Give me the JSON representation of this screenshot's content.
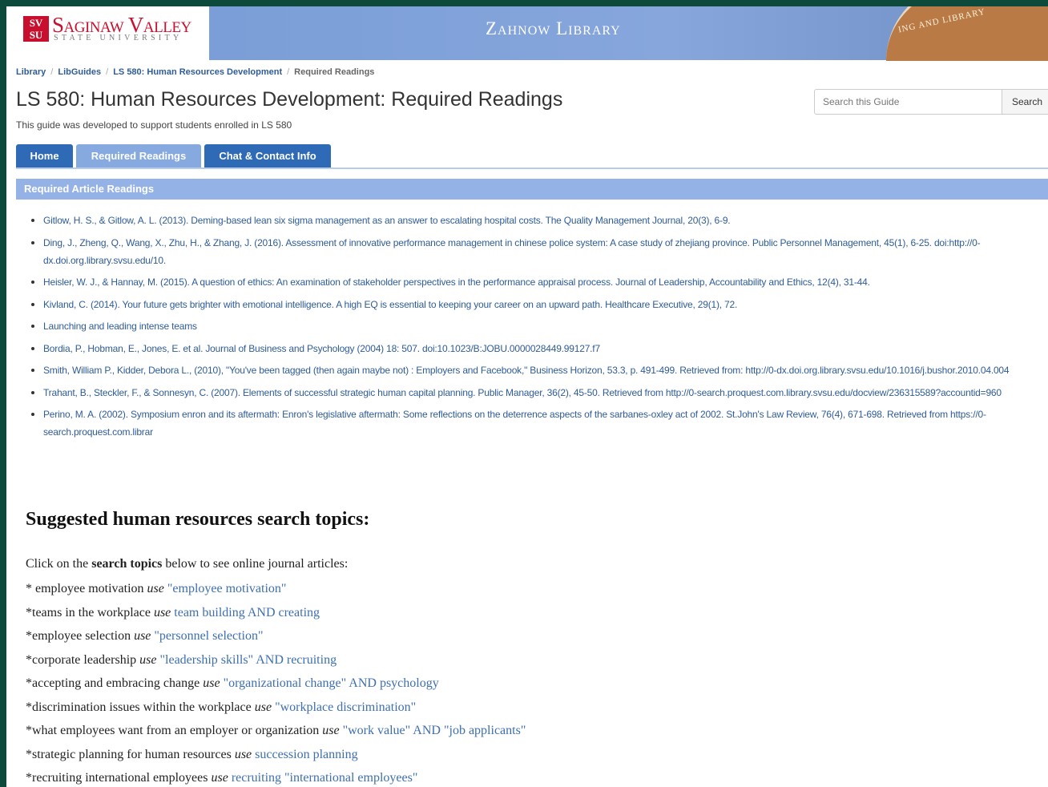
{
  "header": {
    "logo_mark": "SV SU",
    "logo_name": "Saginaw Valley",
    "logo_sub": "STATE UNIVERSITY",
    "library_title": "Zahnow Library",
    "building_sign": "ING AND LIBRARY"
  },
  "breadcrumb": [
    {
      "label": "Library"
    },
    {
      "label": "LibGuides"
    },
    {
      "label": "LS 580: Human Resources Development"
    },
    {
      "label": "Required Readings"
    }
  ],
  "page": {
    "title": "LS 580: Human Resources Development: Required Readings",
    "description": "This guide was developed to support students enrolled in LS 580"
  },
  "search": {
    "placeholder": "Search this Guide",
    "button_label": "Search"
  },
  "tabs": [
    {
      "label": "Home",
      "active": false
    },
    {
      "label": "Required Readings",
      "active": true
    },
    {
      "label": "Chat & Contact Info",
      "active": false
    }
  ],
  "box": {
    "title": "Required Article Readings",
    "readings": [
      "Gitlow, H. S., & Gitlow, A. L. (2013). Deming-based lean six sigma management as an answer to escalating hospital costs. The Quality Management Journal, 20(3), 6-9.",
      "Ding, J., Zheng, Q., Wang, X., Zhu, H., & Zhang, J. (2016). Assessment of innovative performance management in chinese police system: A case study of zhejiang province. Public Personnel Management, 45(1), 6-25. doi:http://0-dx.doi.org.library.svsu.edu/10.",
      "Heisler, W. J., & Hannay, M. (2015). A question of ethics: An examination of stakeholder perspectives in the performance appraisal process. Journal of Leadership, Accountability and Ethics, 12(4), 31-44.",
      "Kivland, C. (2014). Your future gets brighter with emotional intelligence. A high EQ is essential to keeping your career on an upward path. Healthcare Executive, 29(1), 72.",
      "Launching and leading intense teams",
      "Bordia, P., Hobman, E., Jones, E. et al. Journal of Business and Psychology (2004) 18: 507. doi:10.1023/B:JOBU.0000028449.99127.f7",
      "Smith, William P., Kidder, Debora L., (2010), \"You've been tagged (then again maybe not) : Employers and Facebook,\" Business Horizon, 53.3, p. 491-499. Retrieved from: http://0-dx.doi.org.library.svsu.edu/10.1016/j.bushor.2010.04.004",
      "Trahant, B., Steckler, F., & Sonnesyn, C. (2007). Elements of successful strategic human capital planning. Public Manager, 36(2), 45-50. Retrieved from http://0-search.proquest.com.library.svsu.edu/docview/236315589?accountid=960",
      "Perino, M. A. (2002). Symposium enron and its aftermath: Enron's legislative aftermath: Some reflections on the deterrence aspects of the sarbanes-oxley act of 2002. St.John's Law Review, 76(4), 671-698. Retrieved from https://0-search.proquest.com.librar"
    ]
  },
  "topics": {
    "heading": "Suggested human resources search topics:",
    "intro_pre": "Click on the ",
    "intro_bold": "search topics",
    "intro_post": " below to see online journal articles:",
    "use_word": "use",
    "items": [
      {
        "text": "* employee motivation",
        "query": "\"employee motivation\""
      },
      {
        "text": "*teams in the workplace",
        "query": "team building AND creating"
      },
      {
        "text": "*employee selection",
        "query": "\"personnel selection\""
      },
      {
        "text": "*corporate leadership",
        "query": "\"leadership skills\" AND recruiting"
      },
      {
        "text": "*accepting and embracing change",
        "query": "\"organizational change\" AND psychology"
      },
      {
        "text": "*discrimination issues within the workplace",
        "query": "\"workplace discrimination\""
      },
      {
        "text": "*what employees want from an employer or organization",
        "query": "\"work value\" AND \"job applicants\""
      },
      {
        "text": "*strategic planning for human resources",
        "query": "succession planning"
      },
      {
        "text": "*recruiting international employees",
        "query": "recruiting \"international employees\""
      }
    ]
  },
  "colors": {
    "brand_red": "#c8102e",
    "banner_blue": "#7fa0d8",
    "tab_blue": "#2e6ab5",
    "link_blue": "#2e5c99",
    "frame_green": "#0d4a3b"
  }
}
